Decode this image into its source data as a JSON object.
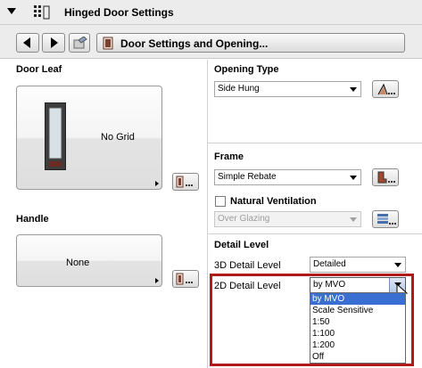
{
  "header": {
    "title": "Hinged Door Settings",
    "icon": "door-settings-grid-icon"
  },
  "toolbar": {
    "section_label": "Door Settings and Opening..."
  },
  "left": {
    "door_leaf": {
      "title": "Door Leaf",
      "preview_text": "No Grid"
    },
    "handle": {
      "title": "Handle",
      "preview_text": "None"
    }
  },
  "right": {
    "opening_type": {
      "title": "Opening Type",
      "value": "Side Hung"
    },
    "frame": {
      "title": "Frame",
      "value": "Simple Rebate"
    },
    "ventilation": {
      "label": "Natural Ventilation",
      "value": "Over Glazing",
      "checked": false
    },
    "detail_level": {
      "title": "Detail Level",
      "label_3d": "3D Detail Level",
      "value_3d": "Detailed",
      "label_2d": "2D Detail Level",
      "value_2d": "by MVO",
      "options": [
        "by MVO",
        "Scale Sensitive",
        "1:50",
        "1:100",
        "1:200",
        "Off"
      ],
      "selected_index": 0
    }
  },
  "colors": {
    "highlight": "#b01a1a",
    "selection": "#3a6fd1"
  }
}
